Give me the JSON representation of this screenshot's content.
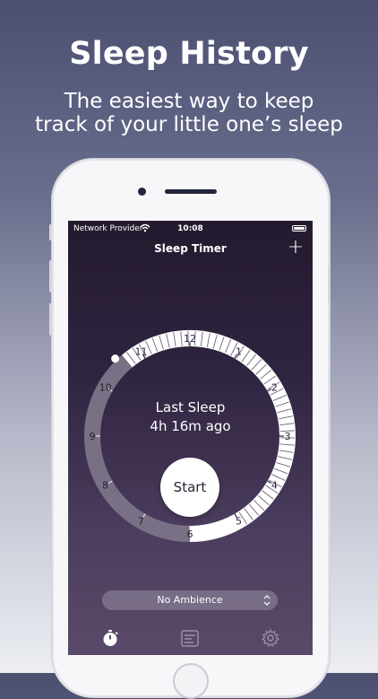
{
  "promo": {
    "headline": "Sleep History",
    "subhead_line1": "The easiest way to keep",
    "subhead_line2": "track of your little one’s sleep"
  },
  "status_bar": {
    "carrier": "Network Provider",
    "time": "10:08"
  },
  "nav": {
    "title": "Sleep Timer",
    "add_label": "+"
  },
  "dial": {
    "hour_labels": [
      "12",
      "1",
      "2",
      "3",
      "4",
      "5",
      "6",
      "7",
      "8",
      "9",
      "10",
      "11"
    ],
    "last_sleep_label": "Last Sleep",
    "last_sleep_ago": "4h 16m ago",
    "start_label": "Start"
  },
  "ambience": {
    "label": "No Ambience",
    "chevron": "⌃⌄"
  },
  "tabs": [
    {
      "name": "timer",
      "icon": "stopwatch-icon"
    },
    {
      "name": "history",
      "icon": "list-icon"
    },
    {
      "name": "settings",
      "icon": "gear-icon"
    }
  ],
  "colors": {
    "accent": "#ffffff",
    "ring_track": "#7a7085",
    "screen_bg": "#2f2440"
  }
}
